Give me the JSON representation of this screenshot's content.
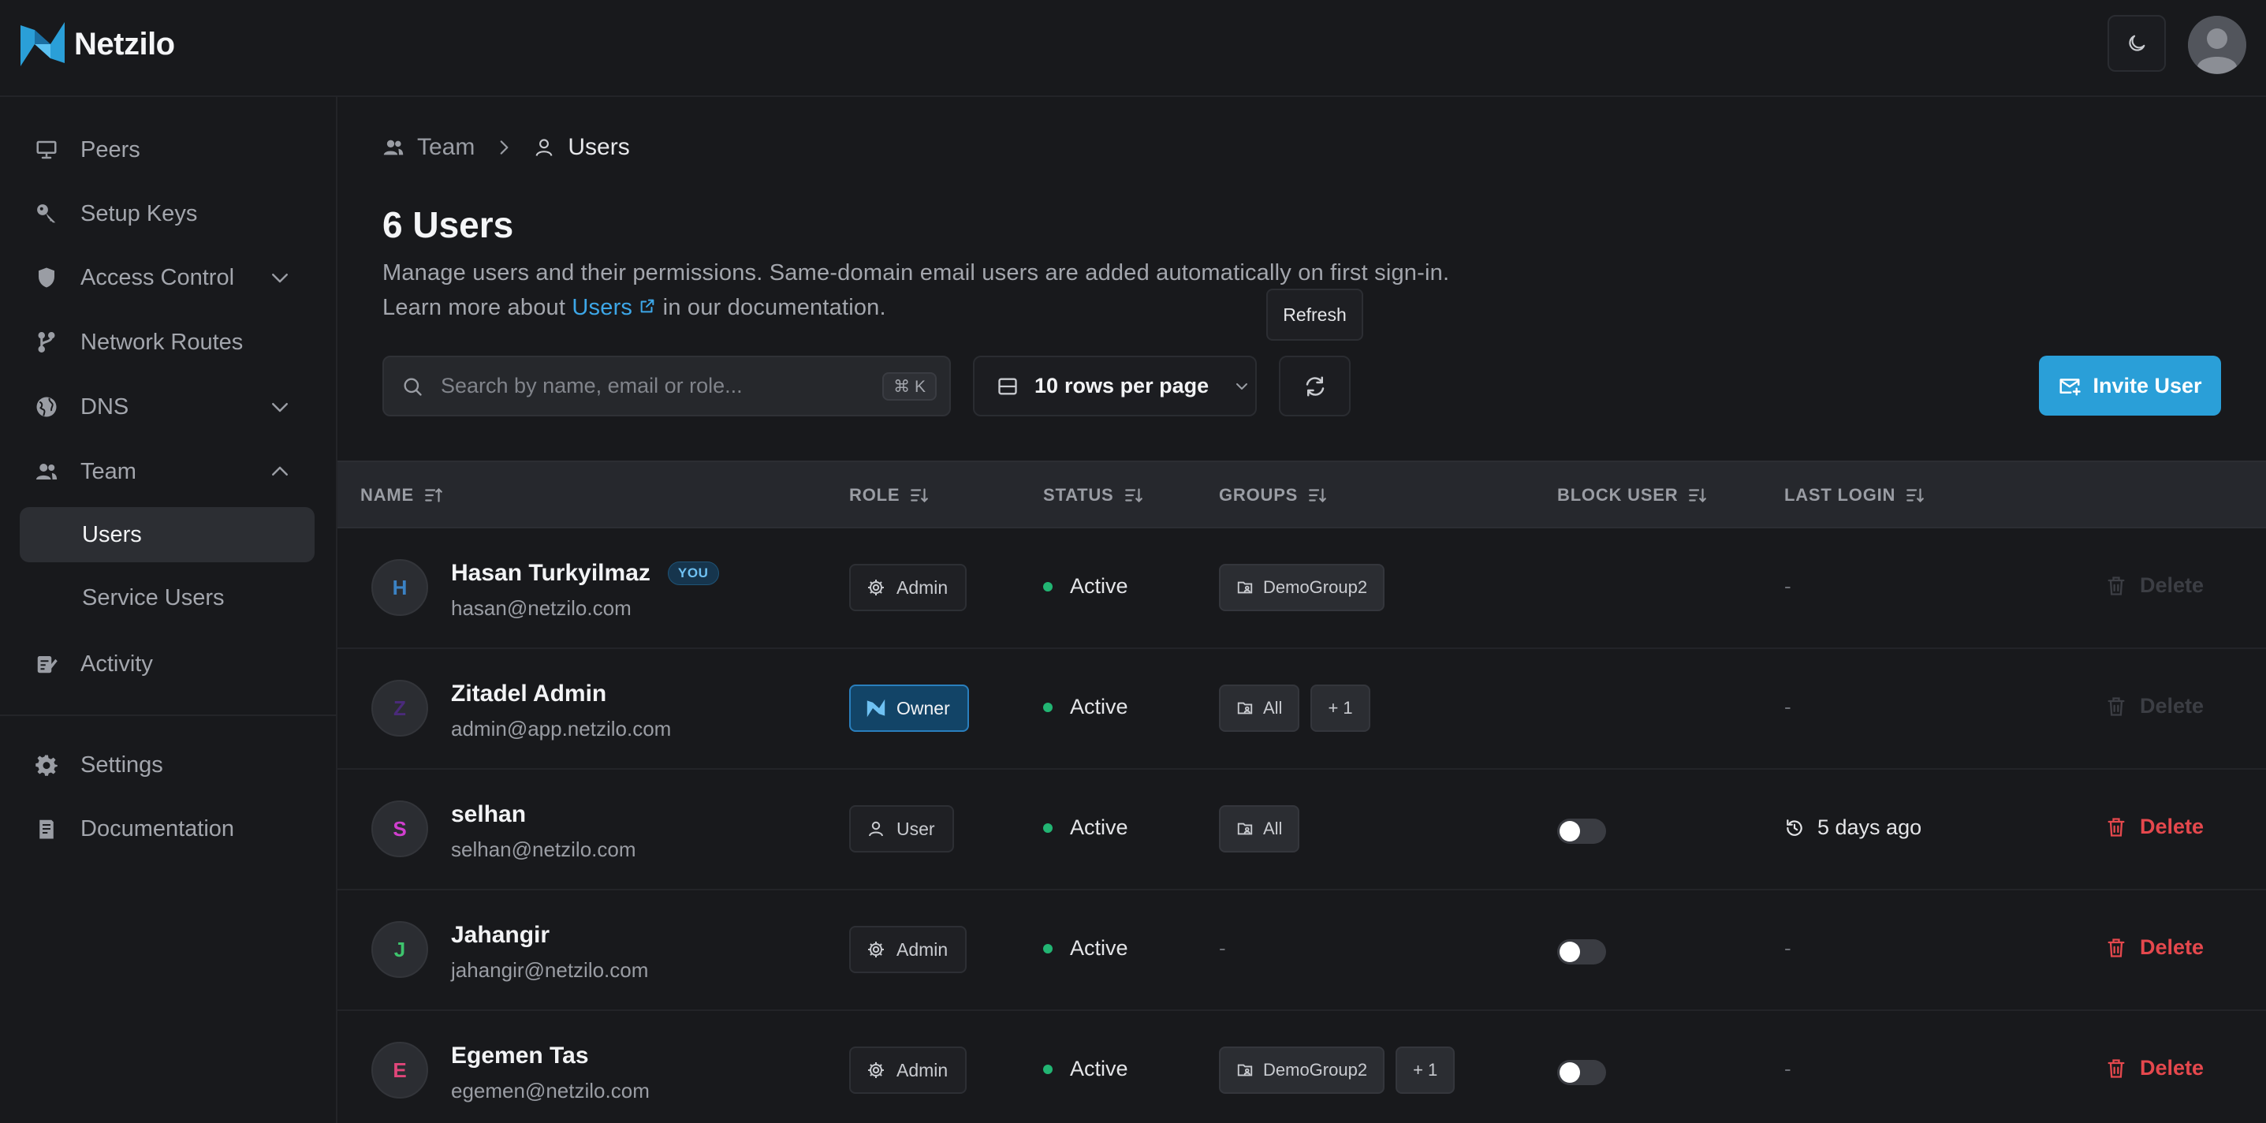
{
  "app": {
    "name": "Netzilo",
    "brand_color": "#2a9fd8"
  },
  "topbar": {
    "theme_toggle_icon": "moon-icon",
    "avatar_icon": "user-avatar-icon"
  },
  "sidebar": {
    "items": [
      {
        "label": "Peers",
        "icon": "monitor-icon"
      },
      {
        "label": "Setup Keys",
        "icon": "key-icon"
      },
      {
        "label": "Access Control",
        "icon": "shield-icon",
        "expandable": true,
        "expanded": false
      },
      {
        "label": "Network Routes",
        "icon": "route-icon"
      },
      {
        "label": "DNS",
        "icon": "globe-icon",
        "expandable": true,
        "expanded": false
      },
      {
        "label": "Team",
        "icon": "team-icon",
        "expandable": true,
        "expanded": true
      },
      {
        "label": "Activity",
        "icon": "activity-icon"
      },
      {
        "label": "Settings",
        "icon": "gear-icon"
      },
      {
        "label": "Documentation",
        "icon": "book-icon"
      }
    ],
    "team_sub": [
      {
        "label": "Users",
        "active": true
      },
      {
        "label": "Service Users",
        "active": false
      }
    ]
  },
  "breadcrumb": {
    "parent": "Team",
    "current": "Users"
  },
  "page": {
    "title": "6 Users",
    "description_line1": "Manage users and their permissions. Same-domain email users are added automatically on first sign-in.",
    "description_prefix": "Learn more about",
    "description_link": "Users",
    "description_suffix": "in our documentation."
  },
  "toolbar": {
    "search_placeholder": "Search by name, email or role...",
    "search_shortcut": "⌘ K",
    "rows_count": "10",
    "rows_label": "rows per page",
    "refresh_tooltip": "Refresh",
    "invite_label": "Invite User"
  },
  "table": {
    "columns": [
      "NAME",
      "ROLE",
      "STATUS",
      "GROUPS",
      "BLOCK USER",
      "LAST LOGIN"
    ],
    "delete_label": "Delete",
    "rows": [
      {
        "initial": "H",
        "initial_color": "#3b82c4",
        "name": "Hasan Turkyilmaz",
        "you": "YOU",
        "email": "hasan@netzilo.com",
        "role": "Admin",
        "status": "Active",
        "groups": [
          "DemoGroup2"
        ],
        "groups_more": "",
        "last_login": "-",
        "delete_enabled": false,
        "block_toggle": false
      },
      {
        "initial": "Z",
        "initial_color": "#4a2a7a",
        "name": "Zitadel Admin",
        "you": "",
        "email": "admin@app.netzilo.com",
        "role": "Owner",
        "status": "Active",
        "groups": [
          "All"
        ],
        "groups_more": "+ 1",
        "last_login": "-",
        "delete_enabled": false,
        "block_toggle": false
      },
      {
        "initial": "S",
        "initial_color": "#d13fcf",
        "name": "selhan",
        "you": "",
        "email": "selhan@netzilo.com",
        "role": "User",
        "status": "Active",
        "groups": [
          "All"
        ],
        "groups_more": "",
        "last_login": "5 days ago",
        "delete_enabled": true,
        "block_toggle": true
      },
      {
        "initial": "J",
        "initial_color": "#3ec46d",
        "name": "Jahangir",
        "you": "",
        "email": "jahangir@netzilo.com",
        "role": "Admin",
        "status": "Active",
        "groups": [],
        "groups_more": "",
        "groups_empty": "-",
        "last_login": "-",
        "delete_enabled": true,
        "block_toggle": true
      },
      {
        "initial": "E",
        "initial_color": "#e0467a",
        "name": "Egemen Tas",
        "you": "",
        "email": "egemen@netzilo.com",
        "role": "Admin",
        "status": "Active",
        "groups": [
          "DemoGroup2"
        ],
        "groups_more": "+ 1",
        "last_login": "-",
        "delete_enabled": true,
        "block_toggle": true
      }
    ]
  }
}
